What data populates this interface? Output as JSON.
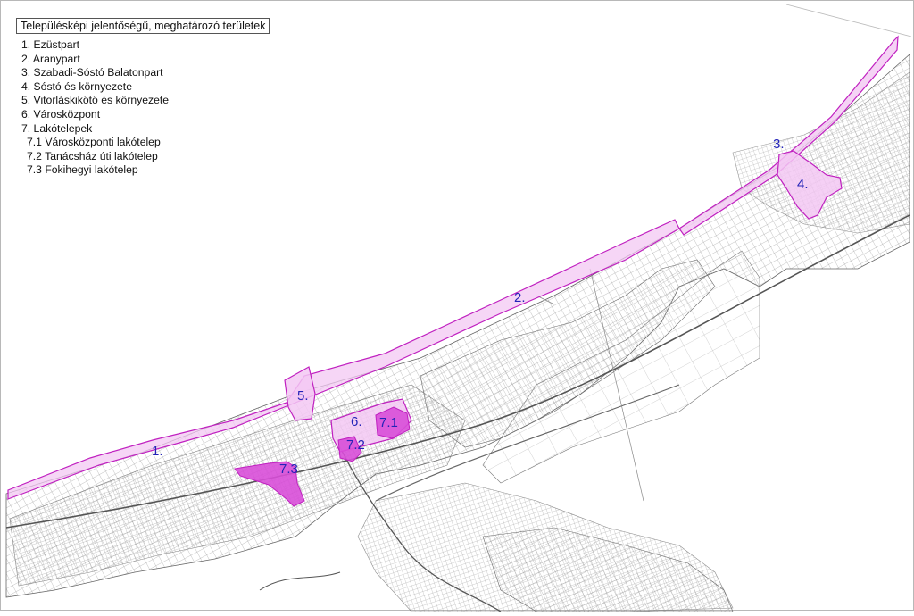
{
  "legend": {
    "title": "Településképi jelentőségű, meghatározó területek",
    "items": [
      {
        "label": "1. Ezüstpart",
        "sub": false
      },
      {
        "label": "2. Aranypart",
        "sub": false
      },
      {
        "label": "3. Szabadi-Sóstó Balatonpart",
        "sub": false
      },
      {
        "label": "4. Sóstó és környezete",
        "sub": false
      },
      {
        "label": "5. Vitorláskikötő és környezete",
        "sub": false
      },
      {
        "label": "6. Városközpont",
        "sub": false
      },
      {
        "label": "7. Lakótelepek",
        "sub": false
      },
      {
        "label": "7.1 Városközponti lakótelep",
        "sub": true
      },
      {
        "label": "7.2 Tanácsház úti lakótelep",
        "sub": true
      },
      {
        "label": "7.3 Fokihegyi lakótelep",
        "sub": true
      }
    ]
  },
  "zones": [
    {
      "id": "1",
      "label": "1."
    },
    {
      "id": "2",
      "label": "2."
    },
    {
      "id": "3",
      "label": "3."
    },
    {
      "id": "4",
      "label": "4."
    },
    {
      "id": "5",
      "label": "5."
    },
    {
      "id": "6",
      "label": "6."
    },
    {
      "id": "7.1",
      "label": "7.1"
    },
    {
      "id": "7.2",
      "label": "7.2"
    },
    {
      "id": "7.3",
      "label": "7.3"
    }
  ],
  "colors": {
    "zone_outline": "#c020c0",
    "zone_fill_light": "#f3c8f3",
    "zone_fill_dense": "#d84ed8",
    "zone_label": "#2323b8",
    "parcel_lines": "#7a7a7a"
  }
}
